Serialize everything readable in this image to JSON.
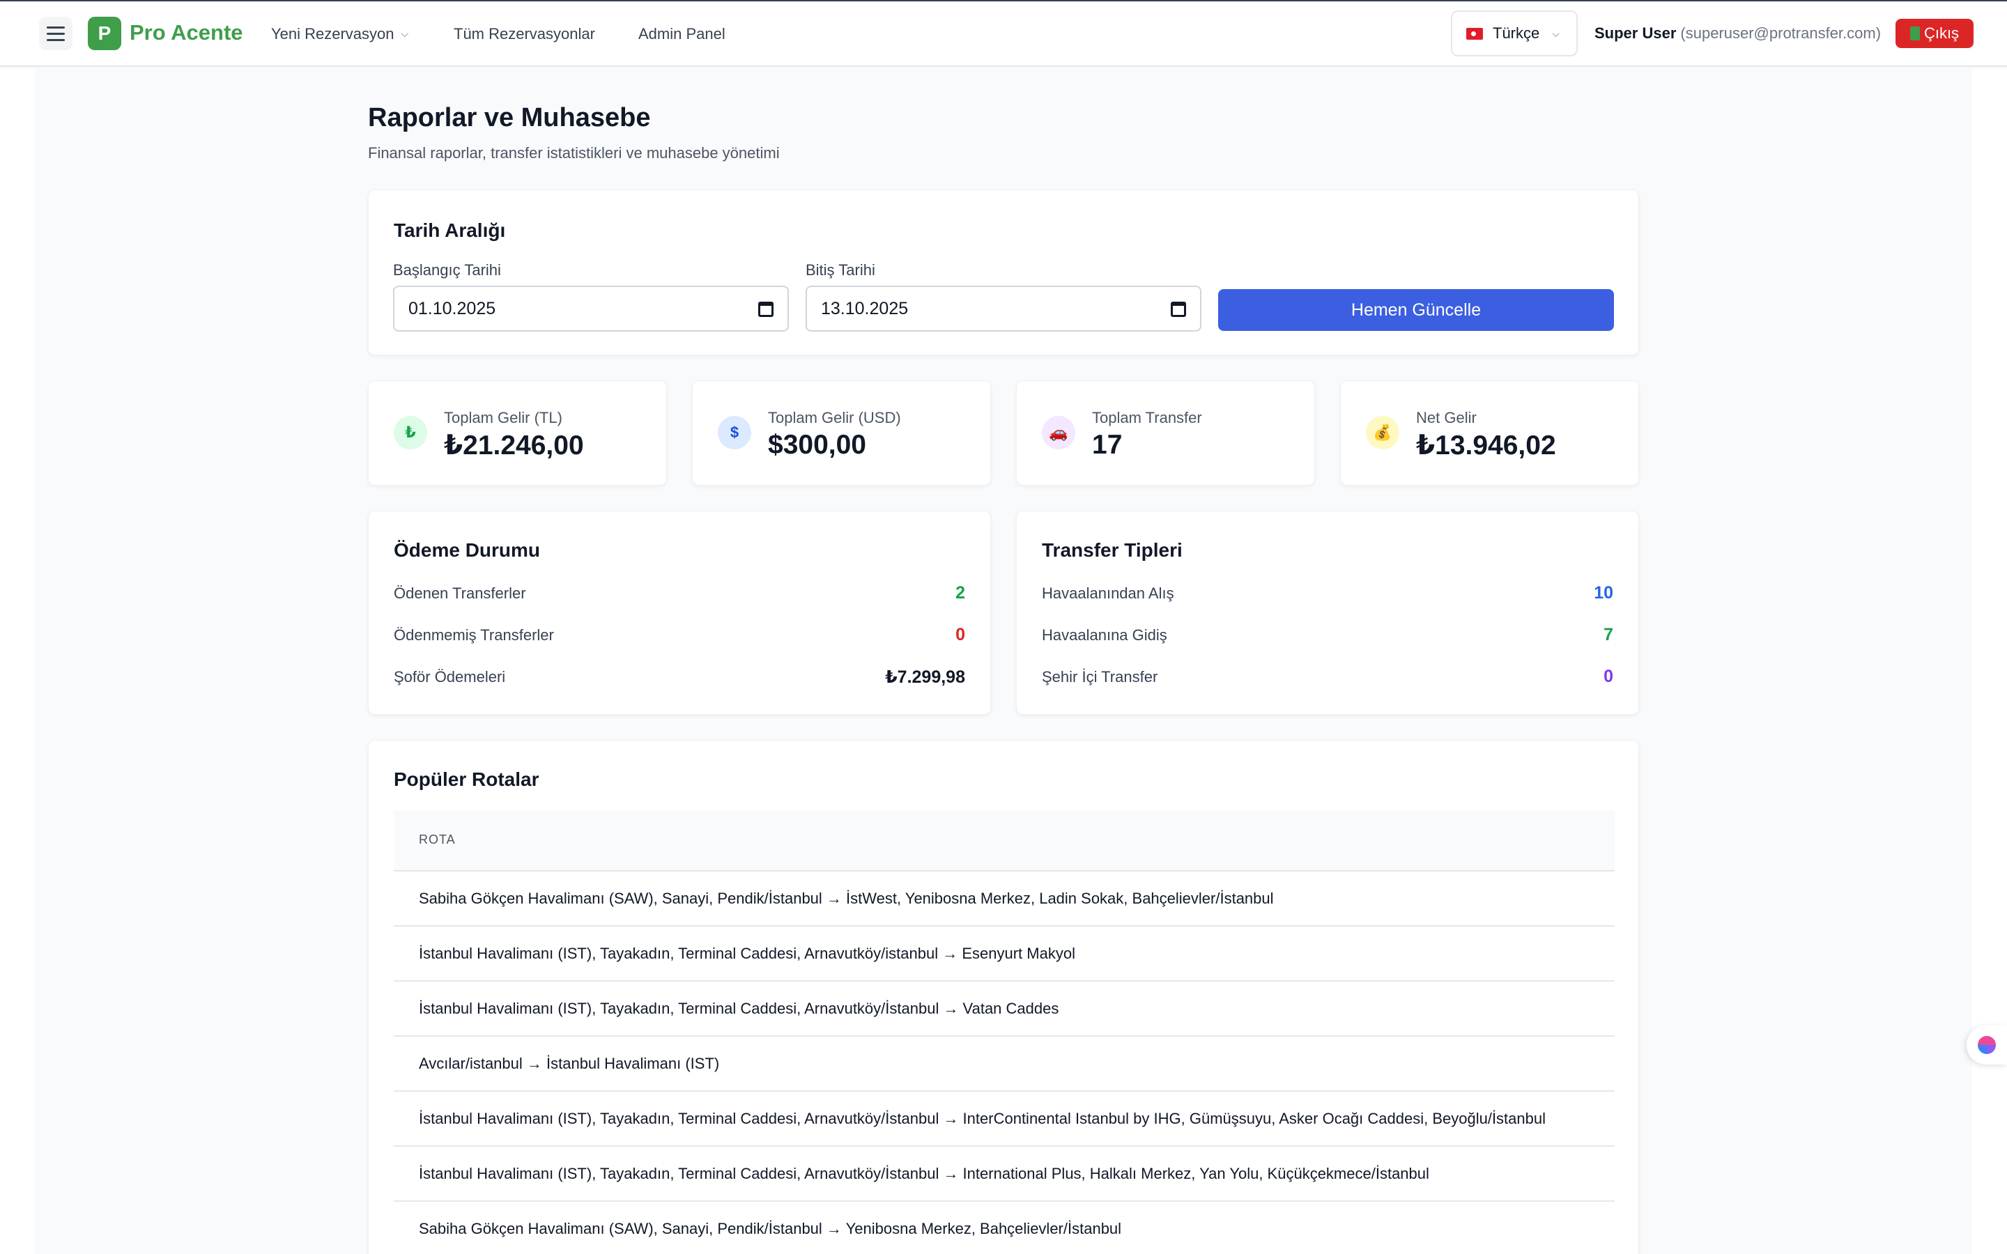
{
  "navbar": {
    "brand_letter": "P",
    "brand_name": "Pro Acente",
    "links": [
      "Yeni Rezervasyon",
      "Tüm Rezervasyonlar",
      "Admin Panel"
    ],
    "language": "Türkçe",
    "user_name": "Super User",
    "user_email": "(superuser@protransfer.com)",
    "logout_label": "Çıkış"
  },
  "header": {
    "title": "Raporlar ve Muhasebe",
    "subtitle": "Finansal raporlar, transfer istatistikleri ve muhasebe yönetimi"
  },
  "date_range": {
    "title": "Tarih Aralığı",
    "start_label": "Başlangıç Tarihi",
    "start_value": "01.10.2025",
    "end_label": "Bitiş Tarihi",
    "end_value": "13.10.2025",
    "update_label": "Hemen Güncelle"
  },
  "stats": [
    {
      "icon": "₺",
      "label": "Toplam Gelir (TL)",
      "value": "₺21.246,00"
    },
    {
      "icon": "$",
      "label": "Toplam Gelir (USD)",
      "value": "$300,00"
    },
    {
      "icon": "🚗",
      "label": "Toplam Transfer",
      "value": "17"
    },
    {
      "icon": "💰",
      "label": "Net Gelir",
      "value": "₺13.946,02"
    }
  ],
  "payment_status": {
    "title": "Ödeme Durumu",
    "rows": [
      {
        "label": "Ödenen Transferler",
        "value": "2"
      },
      {
        "label": "Ödenmemiş Transferler",
        "value": "0"
      },
      {
        "label": "Şoför Ödemeleri",
        "value": "₺7.299,98"
      }
    ]
  },
  "transfer_types": {
    "title": "Transfer Tipleri",
    "rows": [
      {
        "label": "Havaalanından Alış",
        "value": "10"
      },
      {
        "label": "Havaalanına Gidiş",
        "value": "7"
      },
      {
        "label": "Şehir İçi Transfer",
        "value": "0"
      }
    ]
  },
  "popular_routes": {
    "title": "Popüler Rotalar",
    "column": "ROTA",
    "rows": [
      "Sabiha Gökçen Havalimanı (SAW), Sanayi, Pendik/İstanbul → İstWest, Yenibosna Merkez, Ladin Sokak, Bahçelievler/İstanbul",
      "İstanbul Havalimanı (IST), Tayakadın, Terminal Caddesi, Arnavutköy/istanbul → Esenyurt Makyol",
      "İstanbul Havalimanı (IST), Tayakadın, Terminal Caddesi, Arnavutköy/İstanbul → Vatan Caddes",
      "Avcılar/istanbul → İstanbul Havalimanı (IST)",
      "İstanbul Havalimanı (IST), Tayakadın, Terminal Caddesi, Arnavutköy/İstanbul → InterContinental Istanbul by IHG, Gümüşsuyu, Asker Ocağı Caddesi, Beyoğlu/İstanbul",
      "İstanbul Havalimanı (IST), Tayakadın, Terminal Caddesi, Arnavutköy/İstanbul → International Plus, Halkalı Merkez, Yan Yolu, Küçükçekmece/İstanbul",
      "Sabiha Gökçen Havalimanı (SAW), Sanayi, Pendik/İstanbul → Yenibosna Merkez, Bahçelievler/İstanbul"
    ]
  },
  "colors": {
    "brand": "#3f9e4a",
    "primary_button": "#3b5fe0",
    "danger": "#dc2626",
    "paid": "#16a34a",
    "unpaid": "#dc2626",
    "airport_pickup": "#2563eb",
    "airport_dropoff": "#16a34a",
    "city_transfer": "#7c3aed"
  },
  "icons": {
    "menu": "hamburger-icon",
    "calendar": "calendar-icon",
    "assistant": "brain-icon"
  }
}
